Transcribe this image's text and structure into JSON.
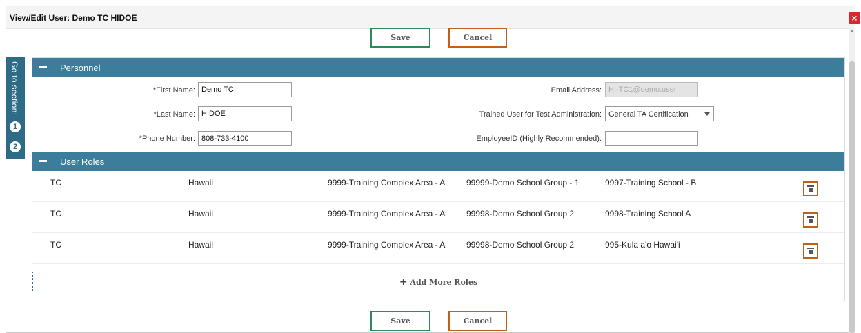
{
  "window": {
    "title": "View/Edit User: Demo TC HIDOE",
    "close_symbol": "×"
  },
  "buttons": {
    "save": "Save",
    "cancel": "Cancel",
    "add_roles_plus": "+",
    "add_roles": "Add More Roles"
  },
  "goto": {
    "label": "Go to section:",
    "items": [
      "1",
      "2"
    ]
  },
  "personnel": {
    "heading": "Personnel",
    "first_name": {
      "label": "*First Name:",
      "value": "Demo TC"
    },
    "last_name": {
      "label": "*Last Name:",
      "value": "HIDOE"
    },
    "phone": {
      "label": "*Phone Number:",
      "value": "808-733-4100"
    },
    "email": {
      "label": "Email Address:",
      "value": "HI-TC1@demo.user"
    },
    "trained": {
      "label": "Trained User for Test Administration:",
      "value": "General TA Certification"
    },
    "employee_id": {
      "label": "EmployeeID (Highly Recommended):",
      "value": ""
    }
  },
  "roles": {
    "heading": "User Roles",
    "rows": [
      [
        "TC",
        "Hawaii",
        "9999-Training Complex Area - A",
        "99999-Demo School Group - 1",
        "9997-Training School - B"
      ],
      [
        "TC",
        "Hawaii",
        "9999-Training Complex Area - A",
        "99998-Demo School Group 2",
        "9998-Training School A"
      ],
      [
        "TC",
        "Hawaii",
        "9999-Training Complex Area - A",
        "99998-Demo School Group 2",
        "995-Kula a'o Hawai'i"
      ]
    ]
  },
  "colors": {
    "header": "#3b7d9a",
    "goto": "#2d6b86",
    "save_border": "#2e8b57",
    "cancel_border": "#c0601a",
    "close": "#d9262f"
  }
}
